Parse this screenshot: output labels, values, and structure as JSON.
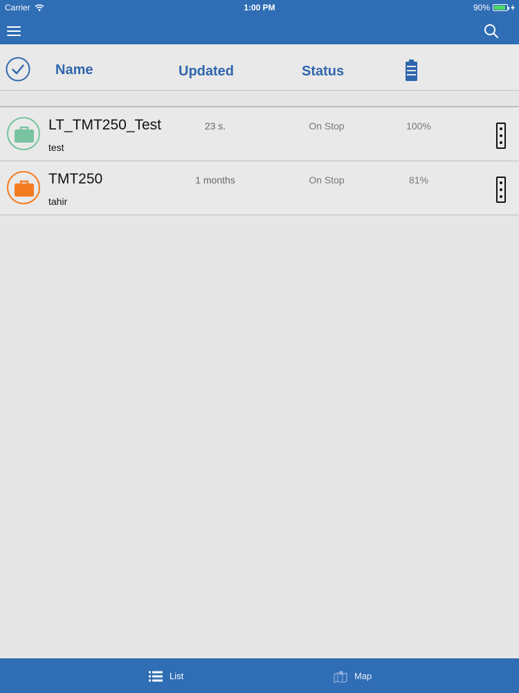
{
  "status_bar": {
    "carrier": "Carrier",
    "time": "1:00 PM",
    "battery_percent": "90%",
    "battery_level": 0.9
  },
  "header": {
    "name_label": "Name",
    "updated_label": "Updated",
    "status_label": "Status"
  },
  "rows": [
    {
      "name": "LT_TMT250_Test",
      "subtitle": "test",
      "updated": "23 s.",
      "status": "On Stop",
      "battery": "100%",
      "icon_color": "#78c4a0"
    },
    {
      "name": "TMT250",
      "subtitle": "tahir",
      "updated": "1 months",
      "status": "On Stop",
      "battery": "81%",
      "icon_color": "#f47c20"
    }
  ],
  "tabbar": {
    "list_label": "List",
    "map_label": "Map"
  },
  "colors": {
    "bar_blue": "#2f6db5",
    "header_text": "#2f66ad"
  }
}
